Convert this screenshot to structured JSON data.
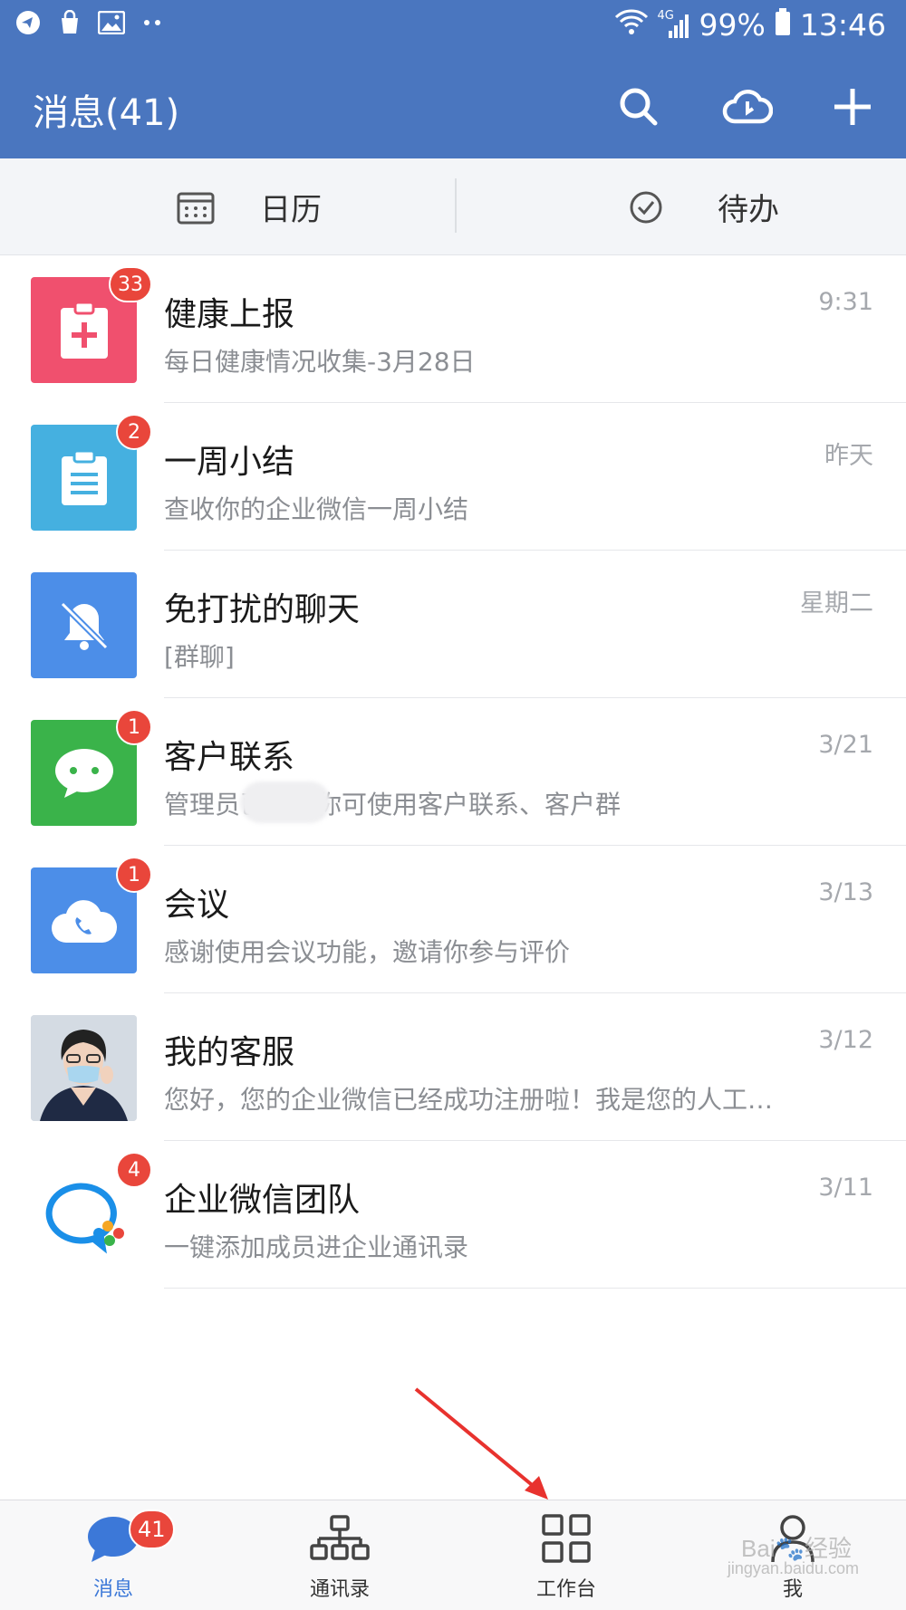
{
  "status_bar": {
    "network": "4G",
    "battery": "99%",
    "time": "13:46"
  },
  "app_bar": {
    "title": "消息(41)"
  },
  "quick_tabs": [
    {
      "label": "日历",
      "icon": "calendar-icon"
    },
    {
      "label": "待办",
      "icon": "check-circle-icon"
    }
  ],
  "messages": [
    {
      "title": "健康上报",
      "subtitle": "每日健康情况收集-3月28日",
      "time": "9:31",
      "badge": "33",
      "icon": "medical-clipboard-icon",
      "color": "#f0506e"
    },
    {
      "title": "一周小结",
      "subtitle": "查收你的企业微信一周小结",
      "time": "昨天",
      "badge": "2",
      "icon": "clipboard-icon",
      "color": "#45b0e0"
    },
    {
      "title": "免打扰的聊天",
      "subtitle": "[群聊]",
      "time": "星期二",
      "badge": "",
      "icon": "bell-muted-icon",
      "color": "#4c8ee8"
    },
    {
      "title": "客户联系",
      "subtitle": "管理员已配置你可使用客户联系、客户群",
      "time": "3/21",
      "badge": "1",
      "icon": "chat-bubble-icon",
      "color": "#3ab34a"
    },
    {
      "title": "会议",
      "subtitle": "感谢使用会议功能，邀请你参与评价",
      "time": "3/13",
      "badge": "1",
      "icon": "cloud-phone-icon",
      "color": "#4c8ee8"
    },
    {
      "title": "我的客服",
      "subtitle": "您好，您的企业微信已经成功注册啦！我是您的人工…",
      "time": "3/12",
      "badge": "",
      "icon": "person-avatar",
      "color": "#cfd6de"
    },
    {
      "title": "企业微信团队",
      "subtitle": "一键添加成员进企业通讯录",
      "time": "3/11",
      "badge": "4",
      "icon": "wecom-logo-icon",
      "color": "#ffffff"
    }
  ],
  "bottom_nav": [
    {
      "label": "消息",
      "badge": "41",
      "icon": "chat-icon",
      "active": true
    },
    {
      "label": "通讯录",
      "icon": "org-chart-icon",
      "active": false
    },
    {
      "label": "工作台",
      "icon": "grid-icon",
      "active": false
    },
    {
      "label": "我",
      "icon": "person-icon",
      "active": false
    }
  ],
  "watermark": {
    "text": "Bai🐾经验",
    "sub": "jingyan.baidu.com"
  },
  "colors": {
    "header": "#4a76bf",
    "badge": "#e9463b",
    "active_tab": "#3c78d8",
    "annotation_arrow": "#e8322e"
  }
}
